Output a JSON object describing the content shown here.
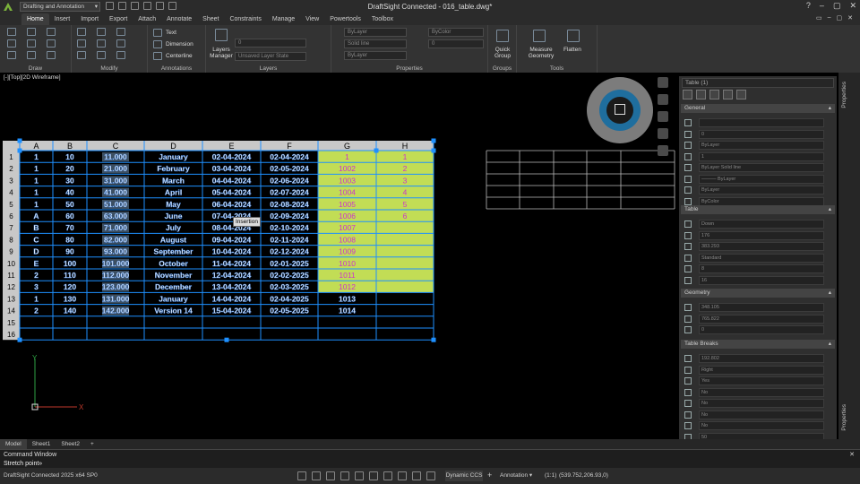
{
  "app": {
    "workspace": "Drafting and Annotation",
    "title": "DraftSight Connected - 016_table.dwg*"
  },
  "menu": {
    "tabs": [
      "Home",
      "Insert",
      "Import",
      "Export",
      "Attach",
      "Annotate",
      "Sheet",
      "Constraints",
      "Manage",
      "View",
      "Powertools",
      "Toolbox"
    ],
    "active": "Home"
  },
  "ribbon": {
    "groups": [
      "Draw",
      "Modify",
      "Annotations",
      "Layers",
      "Properties",
      "Groups",
      "Tools"
    ],
    "text": "Text",
    "dimension": "Dimension",
    "centerline": "Centerline",
    "layers_manager": "Layers Manager",
    "layer_state": "Unsaved Layer State",
    "layer_value": "0",
    "bylayer": "ByLayer",
    "bycolor": "ByColor",
    "solid_line": "Solid line",
    "line_bylayer": "ByLayer",
    "prop_value": "0",
    "quick_group": "Quick Group",
    "measure": "Measure Geometry",
    "flatten": "Flatten"
  },
  "viewport": {
    "label": "[-][Top][2D Wireframe]",
    "tooltip": "Insertion"
  },
  "table": {
    "columns": [
      "A",
      "B",
      "C",
      "D",
      "E",
      "F",
      "G",
      "H"
    ],
    "rows": [
      [
        "1",
        "10",
        "11.000",
        "January",
        "02-04-2024",
        "02-04-2024",
        "1",
        "1"
      ],
      [
        "1",
        "20",
        "21.000",
        "February",
        "03-04-2024",
        "02-05-2024",
        "1002",
        "2"
      ],
      [
        "1",
        "30",
        "31.000",
        "March",
        "04-04-2024",
        "02-06-2024",
        "1003",
        "3"
      ],
      [
        "1",
        "40",
        "41.000",
        "April",
        "05-04-2024",
        "02-07-2024",
        "1004",
        "4"
      ],
      [
        "1",
        "50",
        "51.000",
        "May",
        "06-04-2024",
        "02-08-2024",
        "1005",
        "5"
      ],
      [
        "A",
        "60",
        "63.000",
        "June",
        "07-04-2024",
        "02-09-2024",
        "1006",
        "6"
      ],
      [
        "B",
        "70",
        "71.000",
        "July",
        "08-04-2024",
        "02-10-2024",
        "1007",
        ""
      ],
      [
        "C",
        "80",
        "82.000",
        "August",
        "09-04-2024",
        "02-11-2024",
        "1008",
        ""
      ],
      [
        "D",
        "90",
        "93.000",
        "September",
        "10-04-2024",
        "02-12-2024",
        "1009",
        ""
      ],
      [
        "E",
        "100",
        "101.000",
        "October",
        "11-04-2024",
        "02-01-2025",
        "1010",
        ""
      ],
      [
        "2",
        "110",
        "112.000",
        "November",
        "12-04-2024",
        "02-02-2025",
        "1011",
        ""
      ],
      [
        "3",
        "120",
        "123.000",
        "December",
        "13-04-2024",
        "02-03-2025",
        "1012",
        ""
      ],
      [
        "1",
        "130",
        "131.000",
        "January",
        "14-04-2024",
        "02-04-2025",
        "1013",
        ""
      ],
      [
        "2",
        "140",
        "142.000",
        "Version 14",
        "15-04-2024",
        "02-05-2025",
        "1014",
        ""
      ],
      [
        "",
        "",
        "",
        "",
        "",
        "",
        "",
        ""
      ],
      [
        "",
        "",
        "",
        "",
        "",
        "",
        "",
        ""
      ]
    ]
  },
  "properties": {
    "selector": "Table (1)",
    "sections": {
      "general": "General",
      "table": "Table",
      "geometry": "Geometry",
      "breaks": "Table Breaks"
    },
    "general": [
      "",
      "0",
      "ByLayer",
      "1",
      "ByLayer    Solid line",
      "——— ByLayer",
      "ByLayer",
      "ByColor"
    ],
    "table": [
      "Down",
      "176",
      "383.293",
      "Standard",
      "8",
      "16"
    ],
    "geometry": [
      "348.105",
      "765.822",
      "0"
    ],
    "breaks": [
      "192.802",
      "Right",
      "Yes",
      "No",
      "No",
      "No",
      "No",
      "50"
    ],
    "side_tab": "Properties"
  },
  "layouts": [
    "Model",
    "Sheet1",
    "Sheet2"
  ],
  "command": {
    "title": "Command Window",
    "prompt": "Stretch point»"
  },
  "status": {
    "app": "DraftSight Connected 2025  x64 SP0",
    "dccs": "Dynamic CCS",
    "annotation": "Annotation",
    "scale": "(1:1)",
    "coords": "(539.752,206.93,0)"
  },
  "colors": {
    "accent": "#1e90ff",
    "selected_fill": "#c2dd55",
    "magenta_text": "#cc33cc",
    "cell_text": "#ffffff"
  }
}
